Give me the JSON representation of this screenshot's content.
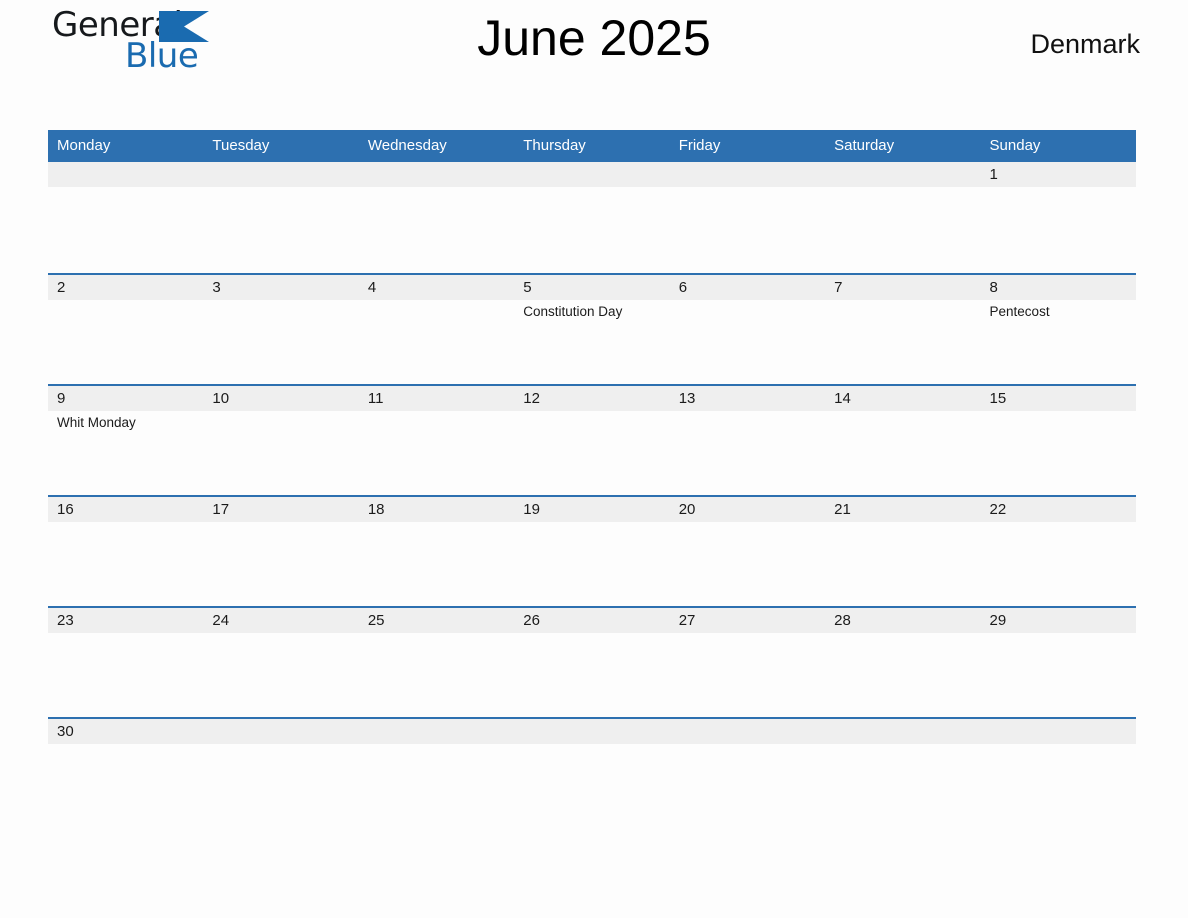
{
  "brand": {
    "name_part1": "General",
    "name_part2": "Blue",
    "triangle_color": "#1a6bb0",
    "text_color": "#16191c"
  },
  "header": {
    "title": "June 2025",
    "country": "Denmark"
  },
  "theme": {
    "accent": "#2d70b0",
    "band": "#efefef",
    "page_bg": "#fdfdfd",
    "text": "#1b1b1b",
    "header_text": "#ffffff"
  },
  "calendar": {
    "weekdays": [
      "Monday",
      "Tuesday",
      "Wednesday",
      "Thursday",
      "Friday",
      "Saturday",
      "Sunday"
    ],
    "weeks": [
      {
        "days": [
          {
            "date": "",
            "events": []
          },
          {
            "date": "",
            "events": []
          },
          {
            "date": "",
            "events": []
          },
          {
            "date": "",
            "events": []
          },
          {
            "date": "",
            "events": []
          },
          {
            "date": "",
            "events": []
          },
          {
            "date": "1",
            "events": []
          }
        ]
      },
      {
        "days": [
          {
            "date": "2",
            "events": []
          },
          {
            "date": "3",
            "events": []
          },
          {
            "date": "4",
            "events": []
          },
          {
            "date": "5",
            "events": [
              "Constitution Day"
            ]
          },
          {
            "date": "6",
            "events": []
          },
          {
            "date": "7",
            "events": []
          },
          {
            "date": "8",
            "events": [
              "Pentecost"
            ]
          }
        ]
      },
      {
        "days": [
          {
            "date": "9",
            "events": [
              "Whit Monday"
            ]
          },
          {
            "date": "10",
            "events": []
          },
          {
            "date": "11",
            "events": []
          },
          {
            "date": "12",
            "events": []
          },
          {
            "date": "13",
            "events": []
          },
          {
            "date": "14",
            "events": []
          },
          {
            "date": "15",
            "events": []
          }
        ]
      },
      {
        "days": [
          {
            "date": "16",
            "events": []
          },
          {
            "date": "17",
            "events": []
          },
          {
            "date": "18",
            "events": []
          },
          {
            "date": "19",
            "events": []
          },
          {
            "date": "20",
            "events": []
          },
          {
            "date": "21",
            "events": []
          },
          {
            "date": "22",
            "events": []
          }
        ]
      },
      {
        "days": [
          {
            "date": "23",
            "events": []
          },
          {
            "date": "24",
            "events": []
          },
          {
            "date": "25",
            "events": []
          },
          {
            "date": "26",
            "events": []
          },
          {
            "date": "27",
            "events": []
          },
          {
            "date": "28",
            "events": []
          },
          {
            "date": "29",
            "events": []
          }
        ]
      },
      {
        "days": [
          {
            "date": "30",
            "events": []
          },
          {
            "date": "",
            "events": []
          },
          {
            "date": "",
            "events": []
          },
          {
            "date": "",
            "events": []
          },
          {
            "date": "",
            "events": []
          },
          {
            "date": "",
            "events": []
          },
          {
            "date": "",
            "events": []
          }
        ]
      }
    ]
  }
}
